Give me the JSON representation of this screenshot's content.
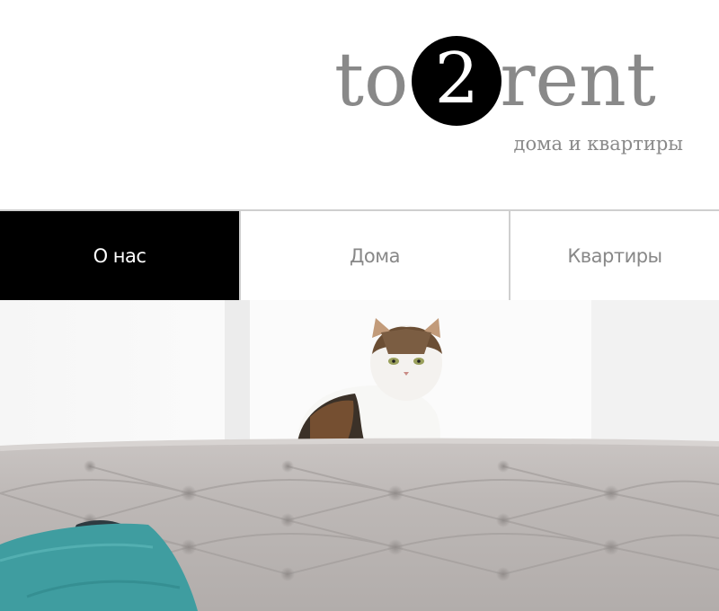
{
  "brand": {
    "prefix": "to",
    "number": "2",
    "suffix": "rent",
    "tagline": "дома и квартиры"
  },
  "nav": {
    "items": [
      {
        "label": "О нас",
        "active": true
      },
      {
        "label": "Дома",
        "active": false
      },
      {
        "label": "Квартиры",
        "active": false
      }
    ]
  },
  "hero": {
    "subject": "cat sitting on the back of a grey tufted sofa with a teal pillow"
  },
  "colors": {
    "logo_text": "#898989",
    "active_tab_bg": "#000000",
    "active_tab_text": "#ffffff",
    "tab_text": "#888888",
    "divider": "#cfcfcf"
  }
}
